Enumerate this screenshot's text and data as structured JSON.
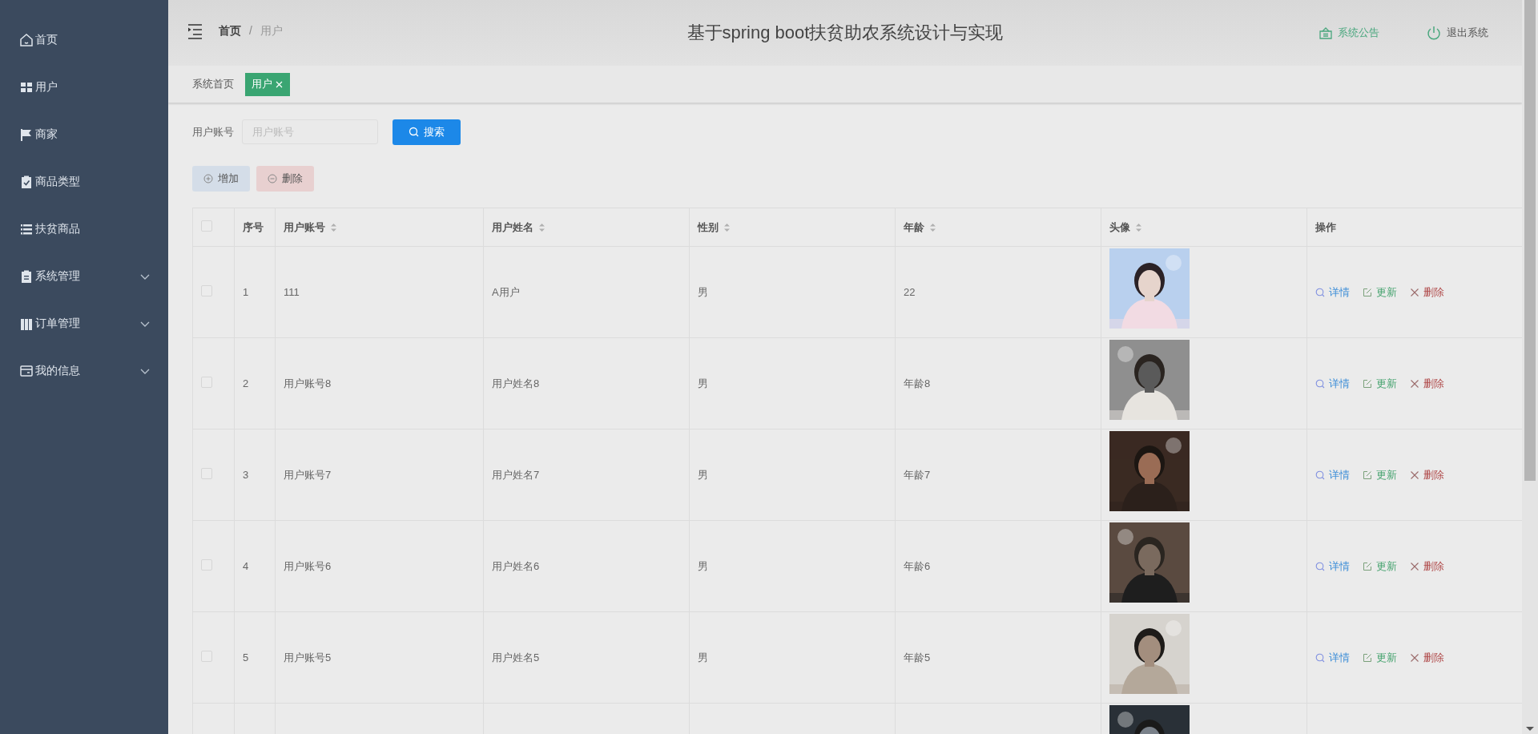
{
  "sidebar": {
    "items": [
      {
        "label": "首页",
        "kind": "link"
      },
      {
        "label": "用户",
        "kind": "link"
      },
      {
        "label": "商家",
        "kind": "link"
      },
      {
        "label": "商品类型",
        "kind": "link"
      },
      {
        "label": "扶贫商品",
        "kind": "link"
      },
      {
        "label": "系统管理",
        "kind": "submenu"
      },
      {
        "label": "订单管理",
        "kind": "submenu"
      },
      {
        "label": "我的信息",
        "kind": "submenu"
      }
    ]
  },
  "header": {
    "breadcrumb": [
      {
        "label": "首页"
      },
      {
        "label": "用户"
      }
    ],
    "breadcrumb_separator": "/",
    "title": "基于spring boot扶贫助农系统设计与实现",
    "actions": [
      {
        "label": "系统公告",
        "kind": "notice"
      },
      {
        "label": "退出系统",
        "kind": "logout"
      }
    ]
  },
  "tabs": [
    {
      "label": "系统首页",
      "selected": false
    },
    {
      "label": "用户",
      "selected": true
    }
  ],
  "search": {
    "label": "用户账号",
    "placeholder": "用户账号",
    "button": "搜索"
  },
  "toolbar": [
    {
      "label": "增加",
      "kind": "add"
    },
    {
      "label": "删除",
      "kind": "delete"
    }
  ],
  "table": {
    "columns": [
      {
        "kind": "check",
        "checked": false
      },
      {
        "label": "序号",
        "kind": "index",
        "sortable": false
      },
      {
        "label": "用户账号",
        "kind": "text",
        "sortable": true
      },
      {
        "label": "用户姓名",
        "kind": "text",
        "sortable": true
      },
      {
        "label": "性别",
        "kind": "text",
        "sortable": true
      },
      {
        "label": "年龄",
        "kind": "text",
        "sortable": true
      },
      {
        "label": "头像",
        "kind": "avatar",
        "sortable": true
      },
      {
        "label": "操作",
        "kind": "actions",
        "sortable": false
      }
    ],
    "rows": [
      {
        "checked": false,
        "cells": [
          "1",
          "111",
          "A用户",
          "男",
          "22"
        ],
        "avatar": {
          "kind": "picture"
        },
        "actions": [
          {
            "label": "详情",
            "kind": "view"
          },
          {
            "label": "更新",
            "kind": "edit"
          },
          {
            "label": "删除",
            "kind": "delete"
          }
        ]
      },
      {
        "checked": false,
        "cells": [
          "2",
          "用户账号8",
          "用户姓名8",
          "男",
          "年龄8"
        ],
        "avatar": {
          "kind": "picture"
        },
        "actions": [
          {
            "label": "详情",
            "kind": "view"
          },
          {
            "label": "更新",
            "kind": "edit"
          },
          {
            "label": "删除",
            "kind": "delete"
          }
        ]
      },
      {
        "checked": false,
        "cells": [
          "3",
          "用户账号7",
          "用户姓名7",
          "男",
          "年龄7"
        ],
        "avatar": {
          "kind": "picture"
        },
        "actions": [
          {
            "label": "详情",
            "kind": "view"
          },
          {
            "label": "更新",
            "kind": "edit"
          },
          {
            "label": "删除",
            "kind": "delete"
          }
        ]
      },
      {
        "checked": false,
        "cells": [
          "4",
          "用户账号6",
          "用户姓名6",
          "男",
          "年龄6"
        ],
        "avatar": {
          "kind": "picture"
        },
        "actions": [
          {
            "label": "详情",
            "kind": "view"
          },
          {
            "label": "更新",
            "kind": "edit"
          },
          {
            "label": "删除",
            "kind": "delete"
          }
        ]
      },
      {
        "checked": false,
        "cells": [
          "5",
          "用户账号5",
          "用户姓名5",
          "男",
          "年龄5"
        ],
        "avatar": {
          "kind": "picture"
        },
        "actions": [
          {
            "label": "详情",
            "kind": "view"
          },
          {
            "label": "更新",
            "kind": "edit"
          },
          {
            "label": "删除",
            "kind": "delete"
          }
        ]
      },
      {
        "avatar": {
          "kind": "picture"
        }
      }
    ]
  }
}
